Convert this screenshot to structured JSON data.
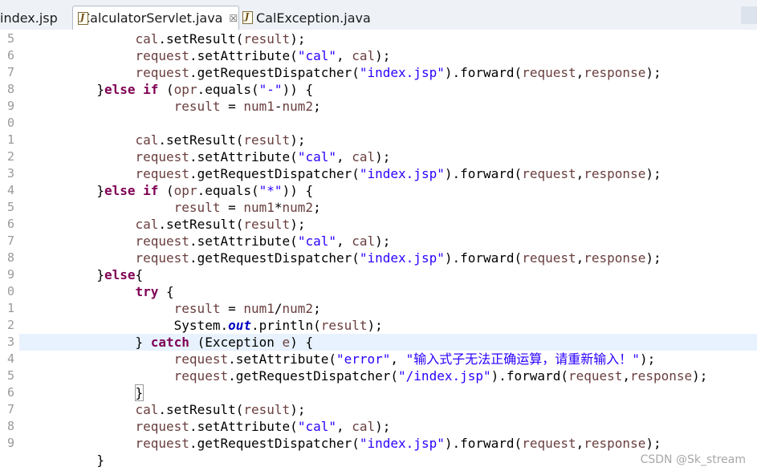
{
  "tabs": [
    {
      "label": "index.jsp",
      "icon": "jsp-file-icon",
      "active": false
    },
    {
      "label": "CalculatorServlet.java",
      "icon": "java-file-icon",
      "active": true,
      "close": "☒"
    },
    {
      "label": "CalException.java",
      "icon": "java-file-icon",
      "active": false
    }
  ],
  "line_numbers": [
    "5",
    "6",
    "7",
    "8",
    "9",
    "0",
    "1",
    "2",
    "3",
    "4",
    "5",
    "6",
    "7",
    "8",
    "9",
    "0",
    "1",
    "2",
    "3",
    "4",
    "5",
    "6",
    "7",
    "8",
    "9",
    ""
  ],
  "code": {
    "set_result": "cal.setResult(result);",
    "set_attr_cal": "request.setAttribute(\"cal\", cal);",
    "get_rd_1": "request.getRequestDispatcher(\"index.jsp\").forward(request,response);",
    "else_if_minus": "}else if (opr.equals(\"-\")) {",
    "assign_minus": "result = num1-num2;",
    "else_if_mul": "}else if (opr.equals(\"*\")) {",
    "assign_mul": "result = num1*num2;",
    "else_open": "}else{",
    "try_open": "try {",
    "assign_div": "result = num1/num2;",
    "println": "System.out.println(result);",
    "catch_line": "} catch (Exception e) {",
    "set_attr_error": "request.setAttribute(\"error\", \"输入式子无法正确运算，请重新输入！\");",
    "get_rd_slash": "request.getRequestDispatcher(\"/index.jsp\").forward(request,response);",
    "close_brace": "}",
    "close_brace_outer": "}"
  },
  "watermark": "CSDN @Sk_stream"
}
